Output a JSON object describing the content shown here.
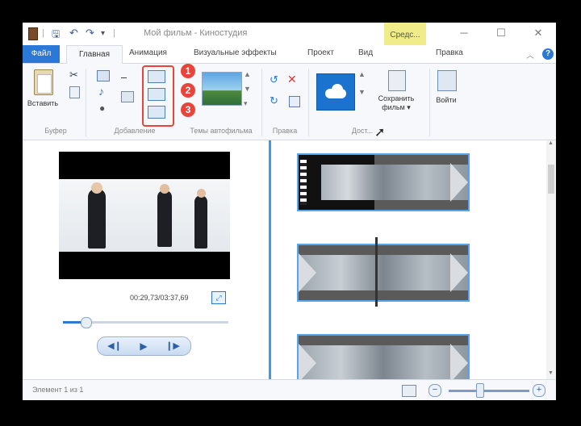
{
  "titlebar": {
    "title": "Мой фильм - Киностудия",
    "contextual_tab": "Средс...",
    "minimize": "─",
    "maximize": "☐",
    "close": "✕",
    "qat_dropdown": "▾"
  },
  "tabs": {
    "file": "Файл",
    "home": "Главная",
    "animation": "Анимация",
    "visual_effects": "Визуальные эффекты",
    "project": "Проект",
    "view": "Вид",
    "edit": "Правка",
    "collapse": "︿",
    "help": "?"
  },
  "ribbon": {
    "clipboard": {
      "paste_label": "Вставить",
      "group_label": "Буфер"
    },
    "add": {
      "group_label": "Добавление"
    },
    "autofilm": {
      "group_label": "Темы автофильма"
    },
    "editing": {
      "group_label": "Правка"
    },
    "share": {
      "group_label": "Дост..."
    },
    "save_movie": {
      "label_line1": "Сохранить",
      "label_line2": "фильм ▾"
    },
    "sign_in": {
      "label": "Войти"
    },
    "badges": [
      "1",
      "2",
      "3"
    ]
  },
  "preview": {
    "time": "00:29,73/03:37,69",
    "seek_position": 0.14
  },
  "statusbar": {
    "status_text": "Элемент 1 из 1",
    "zoom_minus": "−",
    "zoom_plus": "+",
    "zoom_level": 0.4
  },
  "colors": {
    "accent": "#2b78d7",
    "badge": "#e8443a",
    "contextual_tab": "#f1ec8a",
    "timeline_divider": "#3a9be8"
  }
}
